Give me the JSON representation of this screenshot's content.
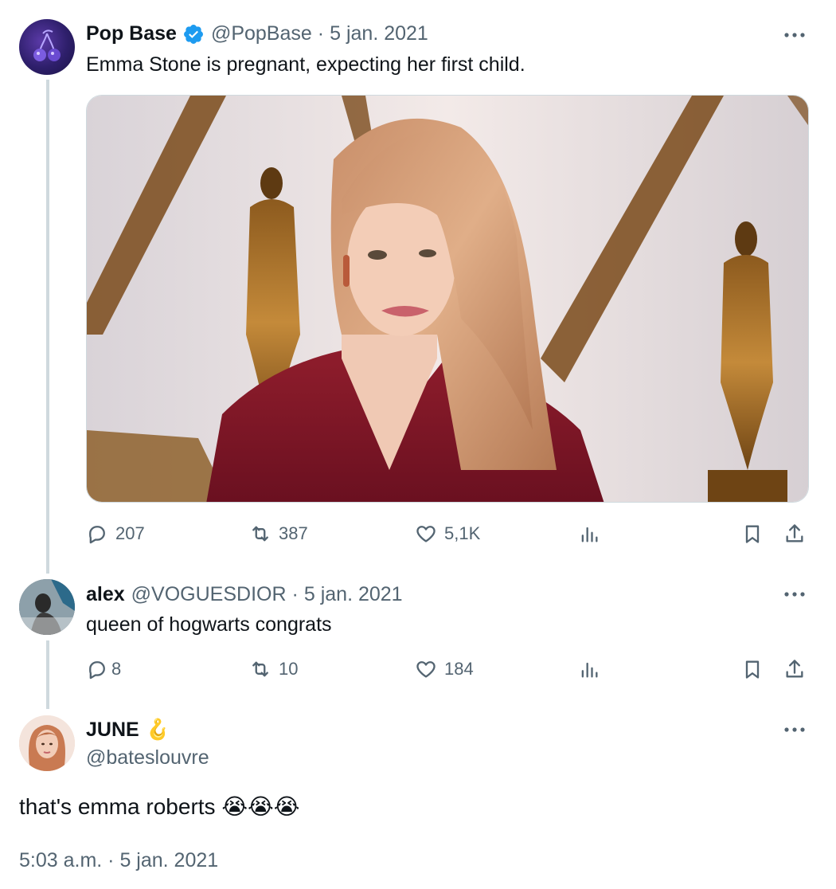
{
  "colors": {
    "verified_badge": "#1d9bf0",
    "thread_line": "#cfd9de",
    "secondary_text": "#536471",
    "primary_text": "#0f1419"
  },
  "tweets": [
    {
      "name": "Pop Base",
      "verified": true,
      "handle": "@PopBase",
      "separator": "·",
      "date": "5 jan. 2021",
      "text": "Emma Stone is pregnant, expecting her first child.",
      "media": "photo: woman with long strawberry-blonde hair in a burgundy blazer in front of golden statue backdrop",
      "actions": {
        "replies": "207",
        "reposts": "387",
        "likes": "5,1K"
      }
    },
    {
      "name": "alex",
      "handle": "@VOGUESDIOR",
      "separator": "·",
      "date": "5 jan. 2021",
      "text": "queen of hogwarts congrats",
      "actions": {
        "replies": "8",
        "reposts": "10",
        "likes": "184"
      }
    },
    {
      "name": "JUNE",
      "name_emoji": "🪝",
      "handle": "@bateslouvre",
      "text": "that's emma roberts 😭😭😭",
      "timestamp": "5:03 a.m. · 5 jan. 2021"
    }
  ],
  "icons": [
    "verified-badge-icon",
    "more-icon",
    "reply-icon",
    "repost-icon",
    "like-icon",
    "views-icon",
    "bookmark-icon",
    "share-icon"
  ]
}
